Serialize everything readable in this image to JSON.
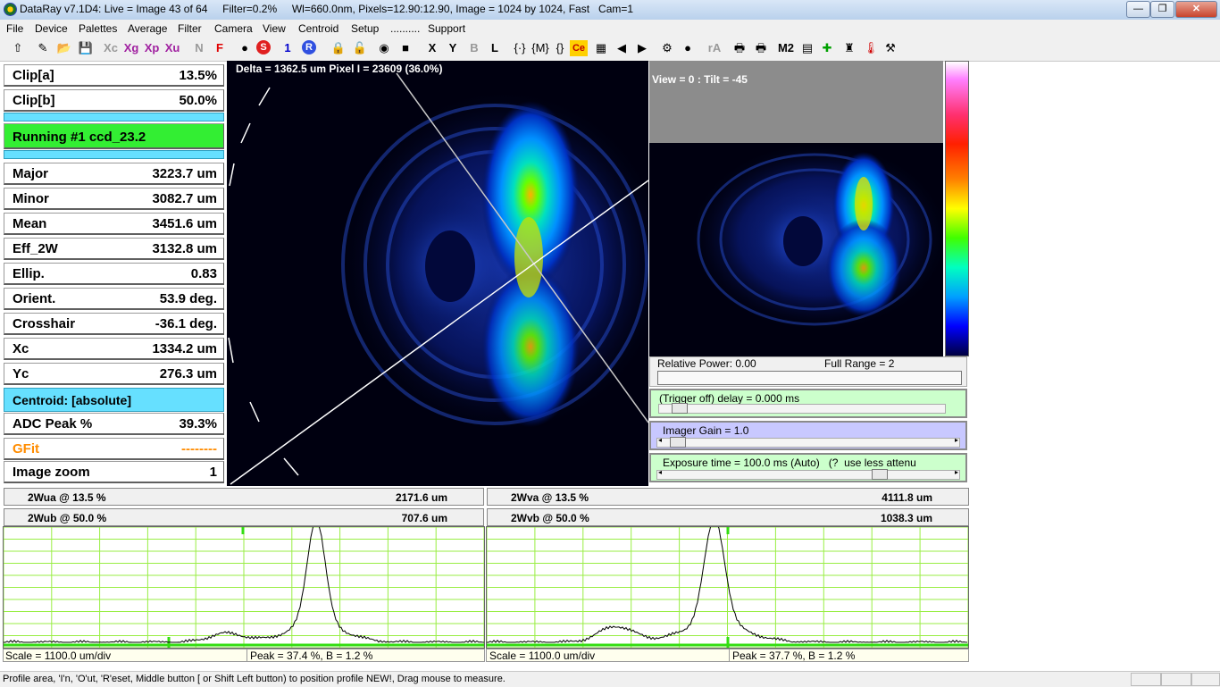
{
  "window": {
    "title": "DataRay v7.1D4: Live = Image 43 of 64     Filter=0.2%     Wl=660.0nm, Pixels=12.90:12.90, Image = 1024 by 1024, Fast   Cam=1",
    "controls": {
      "minimize": "—",
      "maximize": "❐",
      "close": "✕"
    }
  },
  "menu": [
    "File",
    "Device",
    "Palettes",
    "Average",
    "Filter",
    "Camera",
    "View",
    "Centroid",
    "Setup",
    "..........",
    "Support"
  ],
  "toolbar": {
    "items": [
      {
        "label": "⇧",
        "icon": "up-arrow-icon"
      },
      {
        "label": "✎",
        "icon": "pencil-icon"
      },
      {
        "label": "📂",
        "icon": "open-icon"
      },
      {
        "label": "💾",
        "icon": "save-icon"
      },
      {
        "label": "Xc",
        "icon": "xc-text"
      },
      {
        "label": "Xg",
        "icon": "xg-text"
      },
      {
        "label": "Xp",
        "icon": "xp-text"
      },
      {
        "label": "Xu",
        "icon": "xu-text"
      },
      {
        "label": "N",
        "icon": "n-text"
      },
      {
        "label": "F",
        "icon": "f-text"
      },
      {
        "label": "●",
        "icon": "gray-circle-icon"
      },
      {
        "label": "S",
        "icon": "stop-icon"
      },
      {
        "label": "1",
        "icon": "one-text"
      },
      {
        "label": "R",
        "icon": "run-icon"
      },
      {
        "label": "🔒",
        "icon": "lock-icon"
      },
      {
        "label": "🔓",
        "icon": "unlock-icon"
      },
      {
        "label": "◉",
        "icon": "target-icon"
      },
      {
        "label": "■",
        "icon": "gray-square-icon"
      },
      {
        "label": "X",
        "icon": "x-text"
      },
      {
        "label": "Y",
        "icon": "y-text"
      },
      {
        "label": "B",
        "icon": "b-text"
      },
      {
        "label": "L",
        "icon": "l-text"
      },
      {
        "label": "{·}",
        "icon": "brace-icon"
      },
      {
        "label": "{M}",
        "icon": "brace-m-icon"
      },
      {
        "label": "{}",
        "icon": "brace-empty-icon"
      },
      {
        "label": "Ce",
        "icon": "ce-icon"
      },
      {
        "label": "▦",
        "icon": "grid-icon"
      },
      {
        "label": "◀",
        "icon": "back-arrow-icon"
      },
      {
        "label": "▶",
        "icon": "forward-arrow-icon"
      },
      {
        "label": "⚙",
        "icon": "settings-icon"
      },
      {
        "label": "●",
        "icon": "record-icon"
      },
      {
        "label": "rA",
        "icon": "ra-text"
      },
      {
        "label": "🖶",
        "icon": "print-icon"
      },
      {
        "label": "🖶",
        "icon": "print2-icon"
      },
      {
        "label": "M2",
        "icon": "m2-text"
      },
      {
        "label": "▤",
        "icon": "chart-icon"
      },
      {
        "label": "✚",
        "icon": "crosshair-icon"
      },
      {
        "label": "♜",
        "icon": "tower-icon"
      },
      {
        "label": "🌡",
        "icon": "thermometer-icon"
      },
      {
        "label": "⚒",
        "icon": "tools-icon"
      }
    ]
  },
  "params": [
    {
      "label": "Clip[a]",
      "value": "13.5%"
    },
    {
      "label": "Clip[b]",
      "value": "50.0%"
    }
  ],
  "running": "Running #1 ccd_23.2",
  "measurements": [
    {
      "label": "Major",
      "value": "3223.7 um"
    },
    {
      "label": "Minor",
      "value": "3082.7 um"
    },
    {
      "label": "Mean",
      "value": "3451.6 um"
    },
    {
      "label": "Eff_2W",
      "value": "3132.8 um"
    },
    {
      "label": "Ellip.",
      "value": "0.83"
    },
    {
      "label": "Orient.",
      "value": "53.9 deg."
    },
    {
      "label": "Crosshair",
      "value": "-36.1 deg."
    },
    {
      "label": "Xc",
      "value": "1334.2 um"
    },
    {
      "label": "Yc",
      "value": "276.3 um"
    }
  ],
  "centroid": "Centroid: [absolute]",
  "adc": {
    "label": "ADC Peak %",
    "value": "39.3%"
  },
  "gfit": {
    "label": "GFit",
    "value": "--------"
  },
  "zoom": {
    "label": "Image zoom",
    "value": "1"
  },
  "image_overlay": "Delta = 1362.5 um Pixel I = 23609 (36.0%)",
  "view_text": "View = 0 : Tilt = -45",
  "power": {
    "label": "Relative Power: 0.00",
    "range": "Full Range = 2"
  },
  "trigger": "(Trigger off) delay = 0.000 ms",
  "gain": "Imager Gain = 1.0",
  "exposure": "Exposure time = 100.0 ms (Auto)   (?  use less attenu",
  "profiles": [
    {
      "wa_label": "2Wua @ 13.5 %",
      "wa_value": "2171.6 um",
      "wb_label": "2Wub @ 50.0 %",
      "wb_value": "707.6 um",
      "scale": "Scale = 1100.0 um/div",
      "peak": "Peak = 37.4 %,  B = 1.2 %"
    },
    {
      "wa_label": "2Wva @ 13.5 %",
      "wa_value": "4111.8 um",
      "wb_label": "2Wvb @ 50.0 %",
      "wb_value": "1038.3 um",
      "scale": "Scale = 1100.0 um/div",
      "peak": "Peak = 37.7 %,  B = 1.2 %"
    }
  ],
  "status": "Profile area, 'I'n,  'O'ut, 'R'eset, Middle button [ or Shift Left button) to position profile NEW!, Drag mouse to measure.",
  "colors": {
    "accent_green": "#33ee33",
    "cyan": "#66e0ff",
    "grid_green": "#99ee44",
    "gfit_orange": "#ff8c00"
  }
}
